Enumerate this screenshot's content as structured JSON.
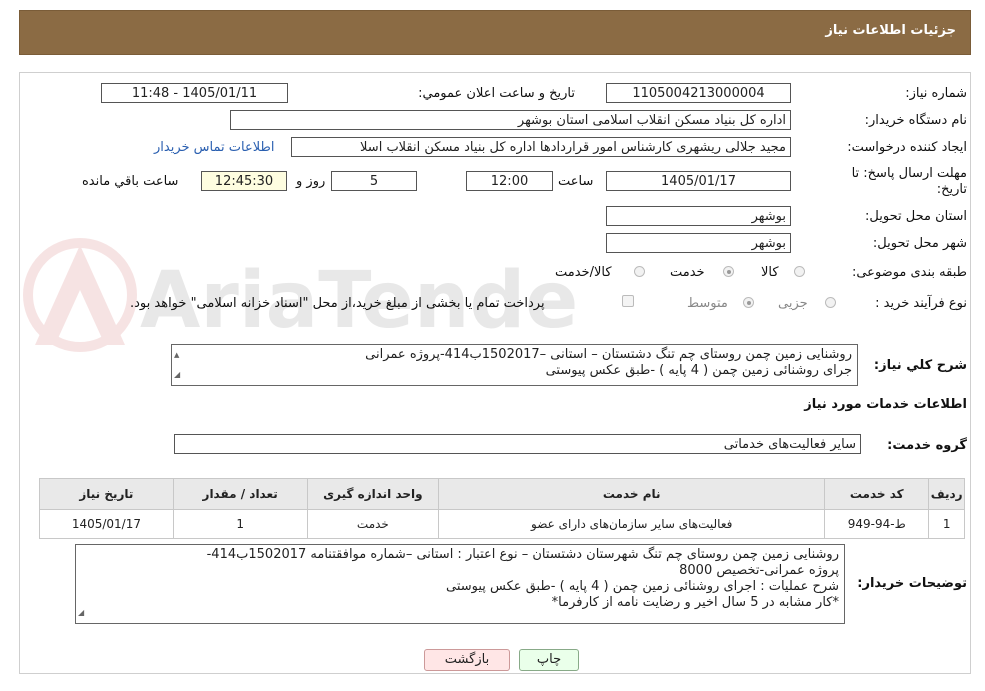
{
  "header": {
    "title": "جزئیات اطلاعات نیاز"
  },
  "form": {
    "need_number_label": "شماره نیاز:",
    "need_number": "1105004213000004",
    "announce_label": "تاریخ و ساعت اعلان عمومي:",
    "announce_value": "1405/01/11 - 11:48",
    "buyer_org_label": "نام دستگاه خریدار:",
    "buyer_org": "اداره کل بنیاد مسکن انقلاب اسلامی استان بوشهر",
    "creator_label": "ایجاد کننده درخواست:",
    "creator": "مجید جلالی ریشهری کارشناس امور قراردادها اداره کل بنیاد مسکن انقلاب اسلا",
    "contact_link": "اطلاعات تماس خریدار",
    "deadline_label": "مهلت ارسال پاسخ: تا تاریخ:",
    "deadline_date": "1405/01/17",
    "time_label": "ساعت",
    "deadline_time": "12:00",
    "days_value": "5",
    "days_label": "روز و",
    "remaining_time": "12:45:30",
    "remaining_label": "ساعت باقي مانده",
    "province_label": "استان محل تحویل:",
    "province": "بوشهر",
    "city_label": "شهر محل تحویل:",
    "city": "بوشهر",
    "category_label": "طبقه بندی موضوعی:",
    "category_options": [
      "کالا",
      "خدمت",
      "کالا/خدمت"
    ],
    "category_selected": "خدمت",
    "process_label": "نوع فرآیند خرید :",
    "process_options": [
      "جزیی",
      "متوسط"
    ],
    "process_selected": "متوسط",
    "payment_note": "پرداخت تمام یا بخشی از مبلغ خرید،از محل \"اسناد خزانه اسلامی\" خواهد بود.",
    "summary_label": "شرح کلي نیاز:",
    "summary_line1": "روشنایی زمین چمن روستای چم تنگ دشتستان – استانی –1502017ب414-پروژه عمرانی",
    "summary_line2": "جرای روشنائی زمین چمن ( 4 پایه ) -طبق عکس پیوستی"
  },
  "services": {
    "section_title": "اطلاعات خدمات مورد نیاز",
    "group_label": "گروه خدمت:",
    "group_value": "سایر فعالیت‌های خدماتی",
    "columns": [
      "ردیف",
      "کد خدمت",
      "نام خدمت",
      "واحد اندازه گیری",
      "تعداد / مقدار",
      "تاریخ نیاز"
    ],
    "rows": [
      [
        "1",
        "ط-94-949",
        "فعالیت‌های سایر سازمان‌های دارای عضو",
        "خدمت",
        "1",
        "1405/01/17"
      ]
    ]
  },
  "buyer_notes": {
    "label": "توضیحات خریدار:",
    "line1": "روشنایی زمین چمن روستای چم تنگ  شهرستان دشتستان – نوع اعتبار : استانی –شماره موافقتنامه 1502017ب414-",
    "line2": "پروژه عمرانی-تخصیص 8000",
    "line3": "شرح عملیات : اجرای روشنائی زمین چمن ( 4 پایه ) -طبق عکس پیوستی",
    "line4": "*کار مشابه در 5 سال اخیر و رضایت نامه از کارفرما*"
  },
  "buttons": {
    "print": "چاپ",
    "back": "بازگشت"
  },
  "watermark_text": "AriaTender.neT",
  "colors": {
    "header_bg": "#8b6b44",
    "link": "#2a5fb0",
    "print_bg": "#eaffea",
    "back_bg": "#ffe6e6"
  }
}
